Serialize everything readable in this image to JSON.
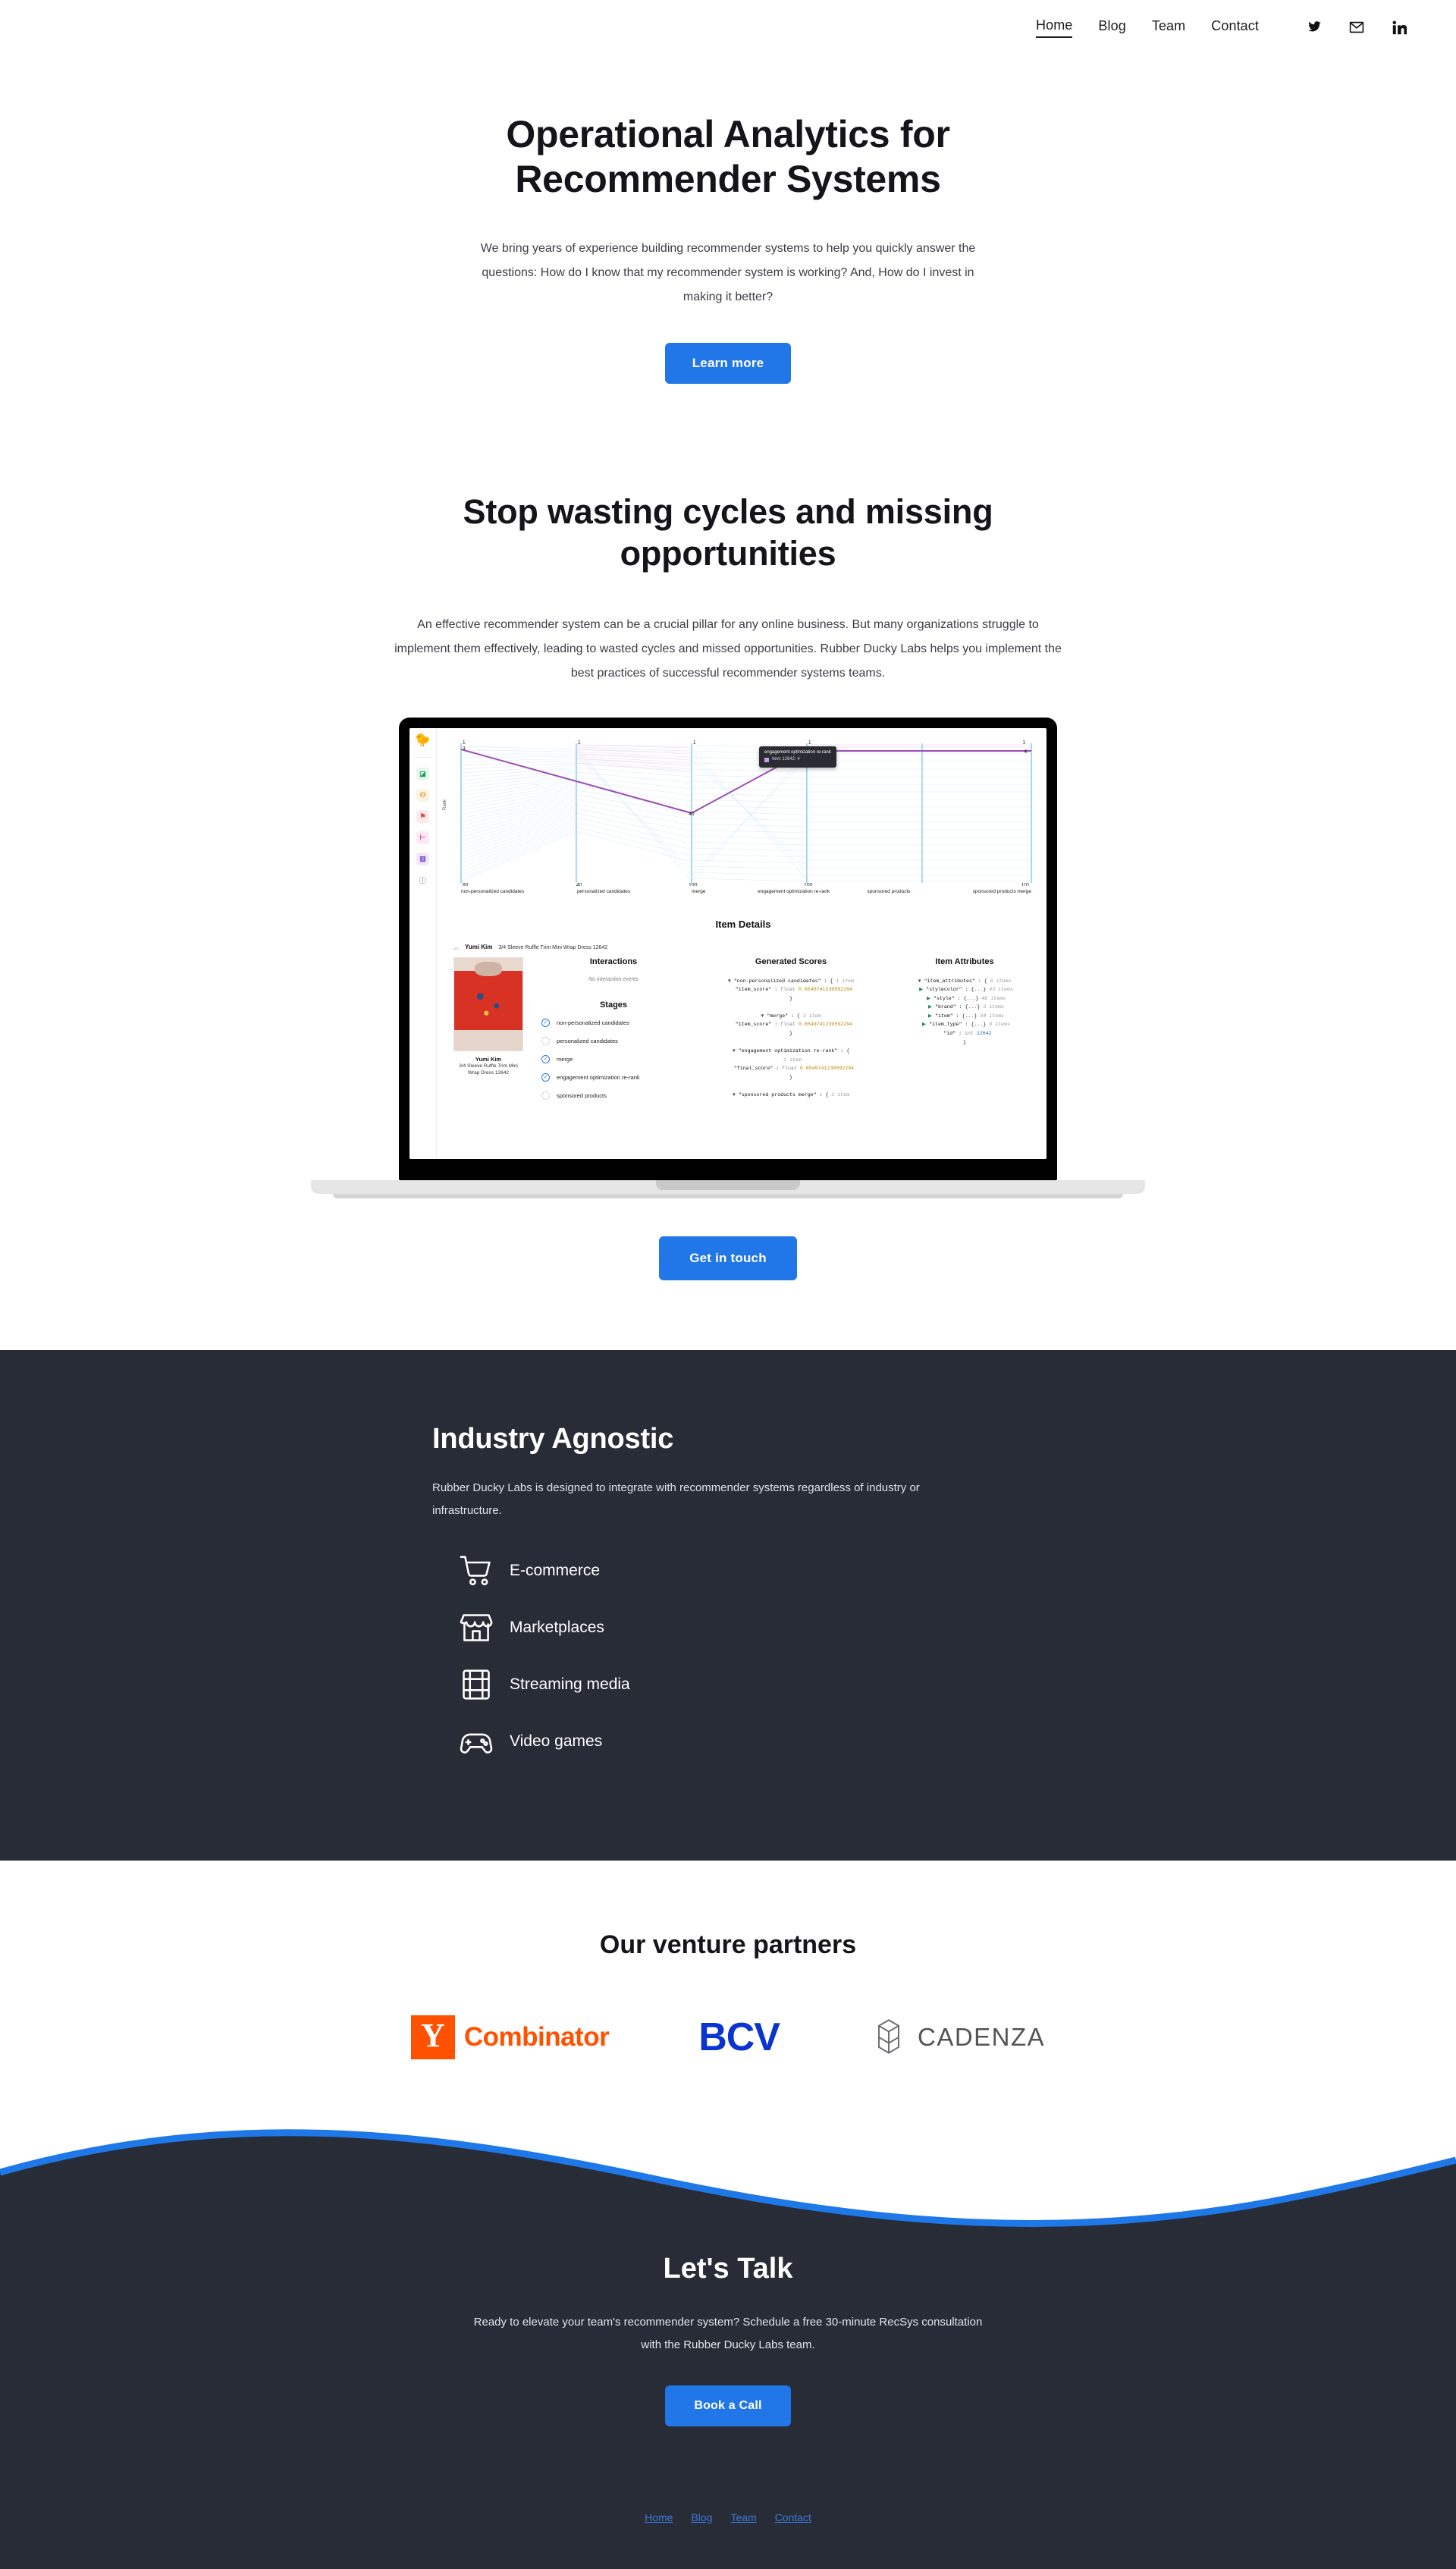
{
  "nav": {
    "links": [
      {
        "label": "Home",
        "active": true
      },
      {
        "label": "Blog",
        "active": false
      },
      {
        "label": "Team",
        "active": false
      },
      {
        "label": "Contact",
        "active": false
      }
    ],
    "icons": [
      "twitter-icon",
      "email-icon",
      "linkedin-icon"
    ]
  },
  "hero": {
    "title_line1": "Operational Analytics for",
    "title_line2": "Recommender Systems",
    "paragraph": "We bring years of experience building recommender systems to help you quickly answer the questions: How do I know that my recommender system is working? And, How do I invest in making it better?",
    "cta_label": "Learn more"
  },
  "problem": {
    "title_line1": "Stop wasting cycles and missing",
    "title_line2": "opportunities",
    "paragraph": "An effective recommender system can be a crucial pillar for any online business. But many organizations struggle to implement them effectively, leading to wasted cycles and missed opportunities. Rubber Ducky Labs helps you implement the best practices of successful recommender systems teams.",
    "cta_label": "Get in touch"
  },
  "app_mock": {
    "logo": "rubber-duck-logo",
    "sidebar_icons": [
      "chart-icon",
      "users-icon",
      "flag-icon",
      "filter-icon",
      "book-icon",
      "info-icon"
    ],
    "chart": {
      "y_axis_label": "Rank",
      "top_ticks": [
        "1",
        "1",
        "1",
        "1",
        "1"
      ],
      "second_tick": "3",
      "bottom_ticks": [
        "60",
        "40",
        "100",
        "100",
        "101"
      ],
      "categories": [
        "non-personalized candidates",
        "personalized candidates",
        "merge",
        "engagement optimization re-rank",
        "sponsored products",
        "sponsored products merge"
      ],
      "highlight_values": [
        "3",
        "40",
        "4",
        "4"
      ],
      "tooltip_title": "engagement optimization re-rank",
      "tooltip_row": "Item 12642: 4",
      "highlight_color": "#9a4fb5"
    },
    "details": {
      "heading": "Item Details",
      "brand": "Yumi Kim",
      "product": "3/4 Sleeve Ruffle Trim Mini Wrap Dress 12642",
      "thumb_caption": "Yumi Kim",
      "thumb_sub": "3/4 Sleeve Ruffle Trim Mini Wrap Dress 12642",
      "interactions_heading": "Interactions",
      "interactions_empty": "No interaction events",
      "stages_heading": "Stages",
      "stages": [
        {
          "label": "non-personalized candidates",
          "done": true
        },
        {
          "label": "personalized candidates",
          "done": false
        },
        {
          "label": "merge",
          "done": true
        },
        {
          "label": "engagement optimization re-rank",
          "done": true
        },
        {
          "label": "sponsored products",
          "done": false
        }
      ],
      "scores_heading": "Generated Scores",
      "score_blocks": [
        {
          "key": "\"non-personalized candidates\"",
          "meta": "1 item",
          "field": "\"item_score\"",
          "type": "float",
          "value": "0.6549741230592294"
        },
        {
          "key": "\"merge\"",
          "meta": "1 item",
          "field": "\"item_score\"",
          "type": "float",
          "value": "0.6549741230592294"
        },
        {
          "key": "\"engagement optimization re-rank\"",
          "meta": "1 item",
          "field": "\"final_score\"",
          "type": "float",
          "value": "0.6549741230592294"
        }
      ],
      "score_last": "\"sponsored products merge\" : {",
      "score_last_meta": "1 item",
      "attrs_heading": "Item Attributes",
      "attrs_root": "\"item_attributes\"",
      "attrs_root_meta": "6 items",
      "attrs": [
        {
          "key": "\"stylecolor\"",
          "meta": "43 items"
        },
        {
          "key": "\"style\"",
          "meta": "46 items"
        },
        {
          "key": "\"brand\"",
          "meta": "3 items"
        },
        {
          "key": "\"item\"",
          "meta": "34 items"
        },
        {
          "key": "\"item_type\"",
          "meta": "6 items"
        }
      ],
      "id_key": "\"id\"",
      "id_type": "int",
      "id_value": "12642"
    }
  },
  "industry": {
    "title": "Industry Agnostic",
    "paragraph": "Rubber Ducky Labs is designed to integrate with recommender systems regardless of industry or infrastructure.",
    "items": [
      {
        "label": "E-commerce",
        "icon": "shopping-cart-icon"
      },
      {
        "label": "Marketplaces",
        "icon": "storefront-icon"
      },
      {
        "label": "Streaming media",
        "icon": "film-strip-icon"
      },
      {
        "label": "Video games",
        "icon": "game-controller-icon"
      }
    ]
  },
  "partners": {
    "title": "Our venture partners",
    "logos": [
      {
        "name": "y-combinator-logo",
        "badge": "Y",
        "text": "Combinator",
        "color": "#ff5100"
      },
      {
        "name": "bcv-logo",
        "text": "BCV",
        "color": "#0a33cf"
      },
      {
        "name": "cadenza-logo",
        "text": "CADENZA",
        "color": "#555555"
      }
    ]
  },
  "cta": {
    "title": "Let's Talk",
    "paragraph": "Ready to elevate your team's recommender system? Schedule a free 30-minute RecSys consultation with the Rubber Ducky Labs team.",
    "button_label": "Book a Call",
    "accent_color": "#2176e8"
  },
  "footer": {
    "links": [
      "Home",
      "Blog",
      "Team",
      "Contact"
    ]
  }
}
